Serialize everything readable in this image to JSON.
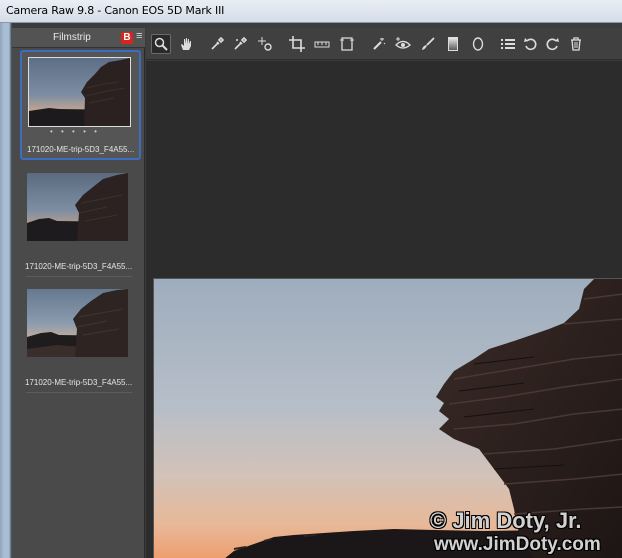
{
  "window": {
    "title": "Camera Raw 9.8  -  Canon EOS 5D Mark III"
  },
  "filmstrip": {
    "title": "Filmstrip",
    "badge_label": "B",
    "menu_icon": "hamburger-menu-icon",
    "thumbnails": [
      {
        "filename": "171020-ME-trip-5D3_F4A55...",
        "selected": true,
        "rating_dots": "• • • • •"
      },
      {
        "filename": "171020-ME-trip-5D3_F4A55...",
        "selected": false
      },
      {
        "filename": "171020-ME-trip-5D3_F4A55...",
        "selected": false
      }
    ]
  },
  "toolbar": {
    "tools": [
      "zoom-tool-icon",
      "hand-tool-icon",
      "white-balance-tool-icon",
      "color-sampler-tool-icon",
      "targeted-adjustment-tool-icon",
      "crop-tool-icon",
      "straighten-tool-icon",
      "transform-tool-icon",
      "spot-removal-tool-icon",
      "red-eye-removal-icon",
      "adjustment-brush-icon",
      "graduated-filter-icon",
      "radial-filter-icon",
      "preferences-icon",
      "rotate-left-icon",
      "rotate-right-icon",
      "trash-icon"
    ]
  },
  "watermark": {
    "line1": "© Jim Doty, Jr.",
    "line2": "www.JimDoty.com"
  },
  "colors": {
    "selection_border": "#3e6cbf",
    "badge_red": "#d7261e",
    "panel_bg": "#4a4a4a",
    "preview_bg": "#2c2c2c"
  }
}
